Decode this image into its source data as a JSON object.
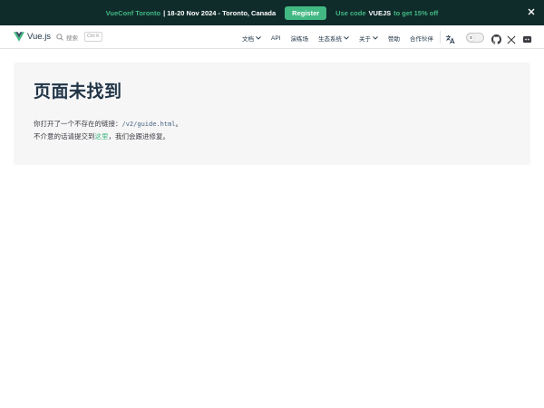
{
  "banner": {
    "event": "VueConf Toronto",
    "details": "| 18-20 Nov 2024 - Toronto, Canada",
    "register": "Register",
    "promo_prefix": "Use code",
    "promo_code": "VUEJS",
    "promo_suffix": "to get 15% off"
  },
  "nav": {
    "logo": "Vue.js",
    "search_label": "搜索",
    "search_kbd": "Ctrl K",
    "menu": [
      "文档",
      "API",
      "演练场",
      "生态系统",
      "关于",
      "赞助",
      "合作伙伴"
    ]
  },
  "page": {
    "title": "页面未找到",
    "line1_prefix": "你打开了一个不存在的链接：",
    "line1_code": "/v2/guide.html",
    "line1_suffix": "。",
    "line2_prefix": "不介意的话请提交到",
    "line2_link": "这里",
    "line2_suffix": "，我们会跟进修复。"
  },
  "colors": {
    "brand": "#42b883",
    "banner_bg": "#0f2b2a",
    "text": "#213547"
  }
}
